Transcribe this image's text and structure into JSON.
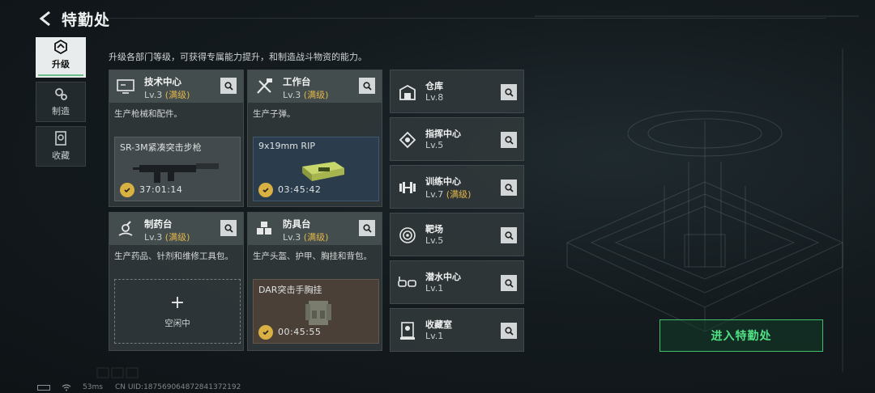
{
  "header": {
    "title": "特勤处"
  },
  "tabs": [
    {
      "label": "升级",
      "icon": "upgrade-icon",
      "active": true
    },
    {
      "label": "制造",
      "icon": "gears-icon",
      "active": false
    },
    {
      "label": "收藏",
      "icon": "collection-icon",
      "active": false
    }
  ],
  "subtitle": "升级各部门等级，可获得专属能力提升，和制造战斗物资的能力。",
  "cards": [
    {
      "name": "技术中心",
      "level": "Lv.3",
      "max": "(满级)",
      "desc": "生产枪械和配件。",
      "product": "SR-3M紧凑突击步枪",
      "time": "37:01:14"
    },
    {
      "name": "工作台",
      "level": "Lv.3",
      "max": "(满级)",
      "desc": "生产子弹。",
      "product": "9x19mm RIP",
      "time": "03:45:42"
    },
    {
      "name": "制药台",
      "level": "Lv.3",
      "max": "(满级)",
      "desc": "生产药品、针剂和维修工具包。",
      "idle_label": "空闲中"
    },
    {
      "name": "防具台",
      "level": "Lv.3",
      "max": "(满级)",
      "desc": "生产头盔、护甲、胸挂和背包。",
      "product": "DAR突击手胸挂",
      "time": "00:45:55"
    }
  ],
  "facilities": [
    {
      "name": "仓库",
      "level": "Lv.8",
      "max": ""
    },
    {
      "name": "指挥中心",
      "level": "Lv.5",
      "max": ""
    },
    {
      "name": "训练中心",
      "level": "Lv.7",
      "max": "(满级)"
    },
    {
      "name": "靶场",
      "level": "Lv.5",
      "max": ""
    },
    {
      "name": "潜水中心",
      "level": "Lv.1",
      "max": ""
    },
    {
      "name": "收藏室",
      "level": "Lv.1",
      "max": ""
    }
  ],
  "enter_button": "进入特勤处",
  "footer": {
    "ping": "53ms",
    "uid": "CN UID:18756906487284137219​2"
  },
  "colors": {
    "accent_green": "#4fe184",
    "max_gold": "#e2b64a",
    "timer_gold": "#d9b143"
  }
}
